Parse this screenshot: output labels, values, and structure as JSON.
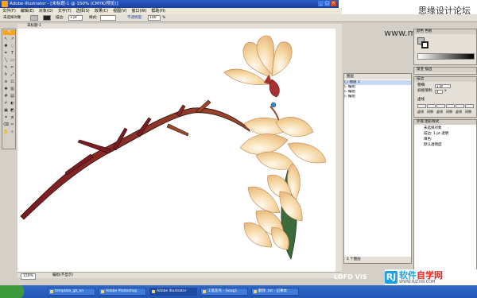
{
  "window": {
    "title": "Adobe Illustrator - [未标题-1 @ 150% (CMYK/预览)]",
    "window_controls": [
      "_",
      "□",
      "×"
    ]
  },
  "watermark_site": "思缘设计论坛 www.missyuan.com",
  "menu": {
    "items": [
      "文件(F)",
      "编辑(E)",
      "对象(O)",
      "文字(T)",
      "选择(S)",
      "效果(C)",
      "视图(V)",
      "窗口(W)",
      "帮助(H)"
    ]
  },
  "control_bar": {
    "selection_label": "未选择对象",
    "stroke_label": "描边:",
    "stroke_value": "1 pt",
    "style_label": "样式:",
    "opacity_label": "不透明度:",
    "opacity_value": "100",
    "opacity_unit": "%"
  },
  "document_tab": {
    "label": "未标题-1"
  },
  "toolbox": {
    "logo": "Ai",
    "tools": [
      "selection-tool",
      "direct-selection-tool",
      "magic-wand-tool",
      "lasso-tool",
      "pen-tool",
      "type-tool",
      "line-tool",
      "rectangle-tool",
      "paintbrush-tool",
      "pencil-tool",
      "rotate-tool",
      "scale-tool",
      "warp-tool",
      "free-transform-tool",
      "symbol-sprayer-tool",
      "graph-tool",
      "mesh-tool",
      "gradient-tool",
      "eyedropper-tool",
      "blend-tool",
      "live-paint-tool",
      "live-paint-select-tool",
      "crop-tool",
      "slice-tool",
      "eraser-tool",
      "scissors-tool",
      "hand-tool",
      "zoom-tool"
    ],
    "glyphs": [
      "↖",
      "↗",
      "✱",
      "◌",
      "✒",
      "T",
      "╲",
      "▭",
      "✎",
      "✏",
      "↻",
      "⤢",
      "≋",
      "⊡",
      "✺",
      "▥",
      "#",
      "▤",
      "✐",
      "◐",
      "▣",
      "◩",
      "⌗",
      "⧄",
      "⌫",
      "✂",
      "✋",
      "⌕"
    ]
  },
  "layers_panel": {
    "tab": "图层",
    "rows": [
      "◯ 图层 1",
      "▷ 编组",
      "▷ 编组",
      "▷ 编组"
    ],
    "footer": "1 个图层"
  },
  "color_panel": {
    "tab": "颜色 色板"
  },
  "gradient_panel": {
    "tab": "渐变 描边"
  },
  "stroke_panel": {
    "tab": "描边",
    "weight_label": "粗细:",
    "weight_value": "1 pt",
    "miter_label": "斜接限制:",
    "miter_value": "4",
    "miter_unit": "x",
    "dashed_label": "虚线",
    "dash_labels": [
      "虚线",
      "间隙",
      "虚线",
      "间隙",
      "虚线",
      "间隙"
    ]
  },
  "appearance_panel": {
    "tab": "外观 图形样式",
    "object": "未选择对象",
    "stroke_row": "描边: 1 pt 透明",
    "fill_row": "填色:",
    "opacity_row": "默认透明度"
  },
  "status_bar": {
    "zoom": "150%",
    "status": "编组(不显示)"
  },
  "taskbar": {
    "items": [
      "template_gb_en",
      "Adobe Photoshop",
      "Adobe Illustrator",
      "工笔花鸟 - Goog1",
      "翻译 .txt - 记事本"
    ]
  },
  "watermark_logo": {
    "lofo": "LOFO VIS",
    "rj": "RJ",
    "cn_blue": "软件",
    "cn_red": "自学网",
    "url": "WWW.RJZXW.COM"
  },
  "colors": {
    "branch_dark": "#7a1a22",
    "branch_light": "#9a4a2a",
    "petal_base": "#f6d9a6",
    "petal_edge": "#e8b77a",
    "leaf_green": "#3b6b3a",
    "bud_red": "#a83232",
    "ai_orange": "#f7a21b",
    "taskbar_blue": "#2357b8"
  }
}
